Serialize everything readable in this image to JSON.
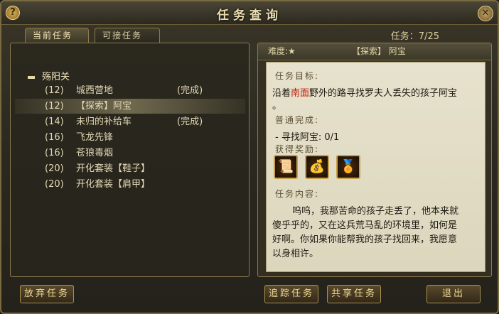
{
  "window": {
    "title": "任务查询",
    "help_glyph": "?",
    "close_glyph": "✕"
  },
  "tabs": [
    {
      "label": "当前任务"
    },
    {
      "label": "可接任务"
    }
  ],
  "quest_count": "任务：7/25",
  "group": {
    "name": "殇阳关"
  },
  "quests": [
    {
      "level": "(12)",
      "name": "城西营地",
      "status": "(完成)"
    },
    {
      "level": "(12)",
      "name": "【探索】阿宝",
      "status": ""
    },
    {
      "level": "(14)",
      "name": "未归的补给车",
      "status": "(完成)"
    },
    {
      "level": "(16)",
      "name": "飞龙先锋",
      "status": ""
    },
    {
      "level": "(16)",
      "name": "苍狼毒烟",
      "status": ""
    },
    {
      "level": "(20)",
      "name": "开化套装【鞋子】",
      "status": ""
    },
    {
      "level": "(20)",
      "name": "开化套装【肩甲】",
      "status": ""
    }
  ],
  "detail": {
    "difficulty_label": "难度:★",
    "quest_title": "【探索】 阿宝",
    "objective_label": "任务目标:",
    "objective_pre": "沿着",
    "objective_highlight": "南面",
    "objective_post": "野外的路寻找罗夫人丢失的孩子阿宝",
    "objective_end": "。",
    "completion_label": "普通完成:",
    "completion_item": "- 寻找阿宝: 0/1",
    "reward_label": "获得奖励:",
    "rewards": [
      {
        "icon": "scroll-icon"
      },
      {
        "icon": "coin-pouch-icon"
      },
      {
        "icon": "badge-icon"
      }
    ],
    "content_label": "任务内容:",
    "content_lines": [
      "呜呜，我那苦命的孩子走丢了，他本来就",
      "傻乎乎的，又在这兵荒马乱的环境里，如何是",
      "好啊。你如果你能帮我的孩子找回来，我愿意",
      "以身相许。"
    ]
  },
  "buttons": {
    "abandon": "放弃任务",
    "track": "追踪任务",
    "share": "共享任务",
    "exit": "退出"
  }
}
